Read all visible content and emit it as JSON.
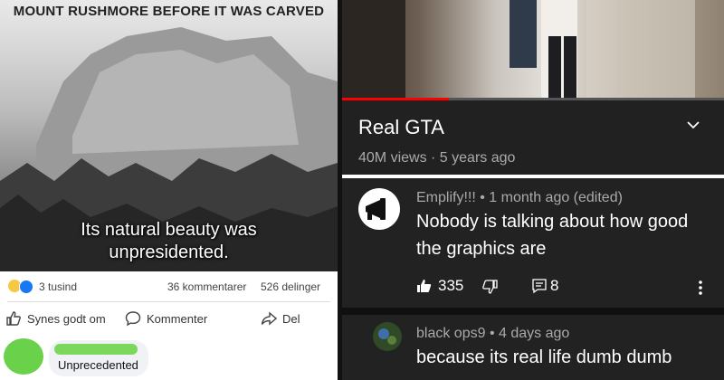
{
  "facebook_post": {
    "meme_title": "MOUNT RUSHMORE BEFORE IT WAS CARVED",
    "meme_caption": "Its natural beauty was unpresidented.",
    "reactions_count": "3 tusind",
    "comments_count": "36 kommentarer",
    "shares_count": "526 delinger",
    "like_label": "Synes godt om",
    "comment_label": "Kommenter",
    "share_label": "Del",
    "comment": {
      "text": "Unprecedented"
    },
    "colors": {
      "like_blue": "#1877f2",
      "avatar_green": "#69d14a",
      "bubble_bg": "#f0f2f5"
    }
  },
  "youtube": {
    "video_title": "Real GTA",
    "video_stats": "40M views · 5 years ago",
    "progress": 0.28,
    "comments": [
      {
        "author": "Emplify!!! • 1 month ago (edited)",
        "text": "Nobody is talking about how good the graphics are",
        "likes": "335",
        "replies": "8"
      },
      {
        "author": "black ops9 • 4 days ago",
        "text": "because its real life dumb dumb"
      }
    ],
    "colors": {
      "background": "#212121",
      "progress": "#ff0000"
    }
  }
}
